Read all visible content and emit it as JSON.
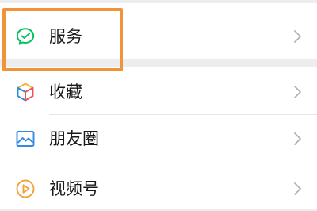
{
  "menu": {
    "items": [
      {
        "label": "服务",
        "icon": "wechat-pay-service-icon",
        "icon_color": "#07c160"
      },
      {
        "label": "收藏",
        "icon": "favorites-cube-icon",
        "icon_color": "#f2b33d"
      },
      {
        "label": "朋友圈",
        "icon": "moments-picture-icon",
        "icon_color": "#2f8be6"
      },
      {
        "label": "视频号",
        "icon": "channels-play-icon",
        "icon_color": "#f0a23a"
      }
    ],
    "chevron_icon": "chevron-right-icon"
  },
  "highlight": {
    "color": "#f0943a",
    "target": "服务"
  }
}
